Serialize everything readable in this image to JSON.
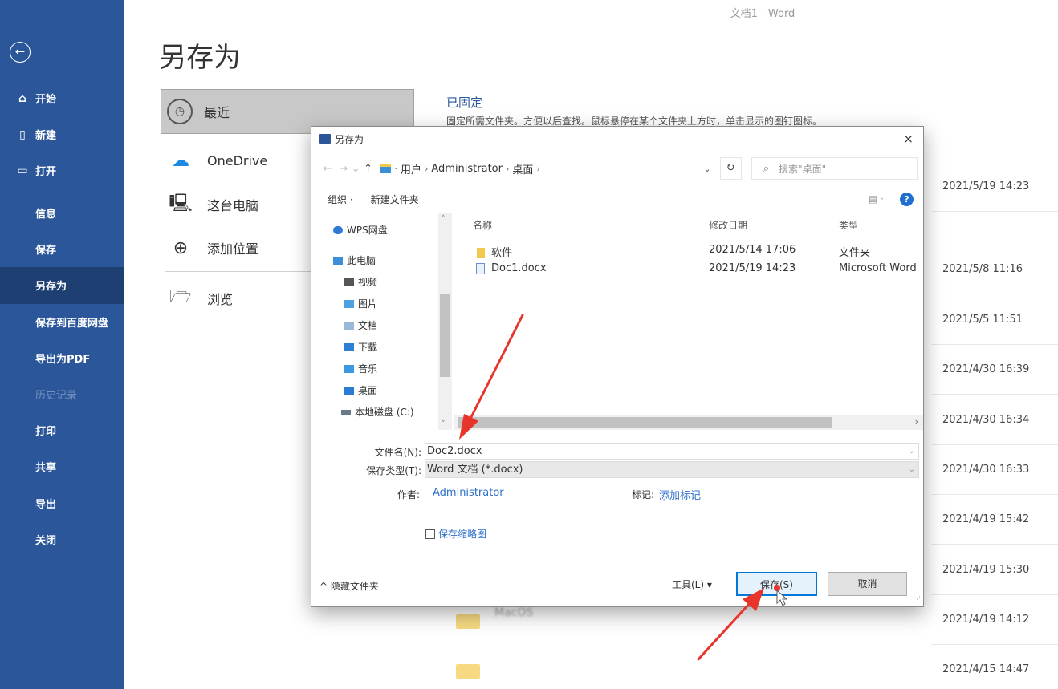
{
  "window": {
    "title": "文档1  -  Word"
  },
  "colors": {
    "sidebar": "#2b579a",
    "sidebar_active": "#1e3f72",
    "accent": "#0078d7",
    "link": "#2f6fcc",
    "annotation": "#e8352b"
  },
  "sidebar": {
    "back_icon": "back-arrow-icon",
    "top_items": [
      {
        "label": "开始",
        "icon": "home-icon"
      },
      {
        "label": "新建",
        "icon": "new-doc-icon"
      },
      {
        "label": "打开",
        "icon": "open-folder-icon"
      }
    ],
    "items": [
      {
        "label": "信息"
      },
      {
        "label": "保存"
      },
      {
        "label": "另存为",
        "active": true
      },
      {
        "label": "保存到百度网盘"
      },
      {
        "label": "导出为PDF"
      },
      {
        "label": "历史记录",
        "disabled": true
      },
      {
        "label": "打印"
      },
      {
        "label": "共享"
      },
      {
        "label": "导出"
      },
      {
        "label": "关闭"
      }
    ]
  },
  "backstage": {
    "title": "另存为",
    "locations": [
      {
        "label": "最近",
        "icon": "clock-icon"
      },
      {
        "label": "OneDrive",
        "icon": "cloud-icon"
      },
      {
        "label": "这台电脑",
        "icon": "computer-icon"
      },
      {
        "label": "添加位置",
        "icon": "globe-plus-icon"
      },
      {
        "label": "浏览",
        "icon": "folder-open-icon"
      }
    ],
    "pinned_title": "已固定",
    "pinned_desc": "固定所需文件夹。方便以后查找。鼠标悬停在某个文件夹上方时，单击显示的图钉图标。",
    "recent_dates": [
      "2021/5/19 14:23",
      "2021/5/8 11:16",
      "2021/5/5 11:51",
      "2021/4/30 16:39",
      "2021/4/30 16:34",
      "2021/4/30 16:33",
      "2021/4/19 15:42",
      "2021/4/19 15:30",
      "2021/4/19 14:12",
      "2021/4/15 14:47"
    ],
    "blurred_item": "MacOS"
  },
  "dialog": {
    "title": "另存为",
    "close": "×",
    "path": {
      "crumbs": [
        "用户",
        "Administrator",
        "桌面"
      ]
    },
    "search_placeholder": "搜索\"桌面\"",
    "toolbar": {
      "organize": "组织 ·",
      "new_folder": "新建文件夹",
      "view": "▤ ·",
      "help": "?"
    },
    "nav_items": [
      {
        "label": "WPS网盘",
        "icon": "wps-cloud-icon"
      },
      {
        "label": "此电脑",
        "icon": "this-pc-icon"
      },
      {
        "label": "视频",
        "icon": "video-icon"
      },
      {
        "label": "图片",
        "icon": "pictures-icon"
      },
      {
        "label": "文档",
        "icon": "documents-icon"
      },
      {
        "label": "下载",
        "icon": "download-icon"
      },
      {
        "label": "音乐",
        "icon": "music-icon"
      },
      {
        "label": "桌面",
        "icon": "desktop-icon"
      },
      {
        "label": "本地磁盘 (C:)",
        "icon": "disk-icon"
      }
    ],
    "columns": {
      "name": "名称",
      "date": "修改日期",
      "type": "类型"
    },
    "files": [
      {
        "name": "软件",
        "date": "2021/5/14 17:06",
        "type": "文件夹"
      },
      {
        "name": "Doc1.docx",
        "date": "2021/5/19 14:23",
        "type": "Microsoft Word"
      }
    ],
    "filename_label": "文件名(N):",
    "filename_value": "Doc2.docx",
    "filetype_label": "保存类型(T):",
    "filetype_value": "Word 文档 (*.docx)",
    "author_label": "作者:",
    "author_value": "Administrator",
    "tags_label": "标记:",
    "tags_value": "添加标记",
    "thumbnail_label": "保存缩略图",
    "hide_folders": "隐藏文件夹",
    "tools": "工具(L)",
    "save": "保存(S)",
    "cancel": "取消"
  }
}
